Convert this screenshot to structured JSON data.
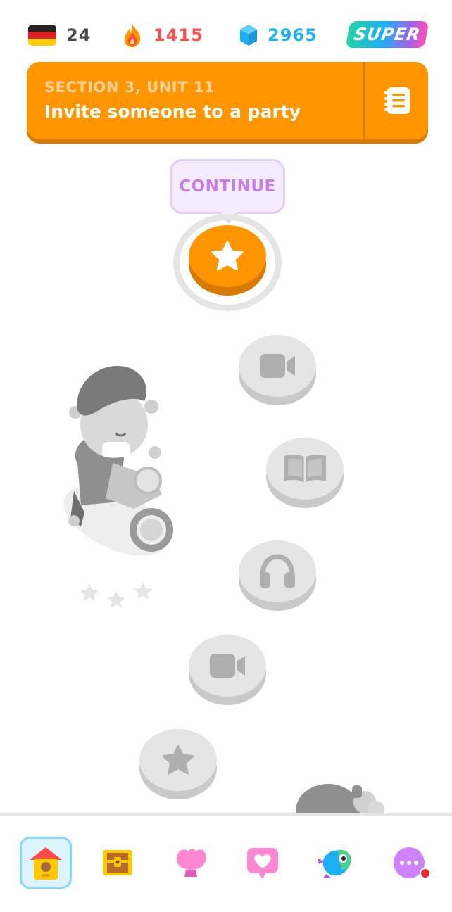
{
  "topbar": {
    "language": {
      "icon": "german-flag-icon",
      "count": "24"
    },
    "streak": {
      "icon": "fire-icon",
      "count": "1415",
      "color": "#ff4b4b"
    },
    "gems": {
      "icon": "gem-icon",
      "count": "2965",
      "color": "#1cb0f6"
    },
    "super_label": "SUPER"
  },
  "unit": {
    "section_label": "SECTION 3, UNIT 11",
    "title": "Invite someone to a party",
    "guide_icon": "guidebook-icon",
    "color": "#ff9600"
  },
  "tooltip": {
    "label": "CONTINUE",
    "color": "#c77ce8"
  },
  "path": {
    "nodes": [
      {
        "icon": "star-icon",
        "state": "active"
      },
      {
        "icon": "video-camera-icon",
        "state": "locked"
      },
      {
        "icon": "book-icon",
        "state": "locked"
      },
      {
        "icon": "headphones-icon",
        "state": "locked"
      },
      {
        "icon": "video-camera-icon",
        "state": "locked"
      },
      {
        "icon": "star-icon",
        "state": "locked"
      }
    ]
  },
  "bottom_nav": {
    "items": [
      {
        "icon": "home-icon",
        "selected": true
      },
      {
        "icon": "treasure-chest-icon"
      },
      {
        "icon": "shell-icon"
      },
      {
        "icon": "heart-chat-icon"
      },
      {
        "icon": "duo-bird-icon"
      },
      {
        "icon": "more-icon",
        "notification": true
      }
    ]
  }
}
